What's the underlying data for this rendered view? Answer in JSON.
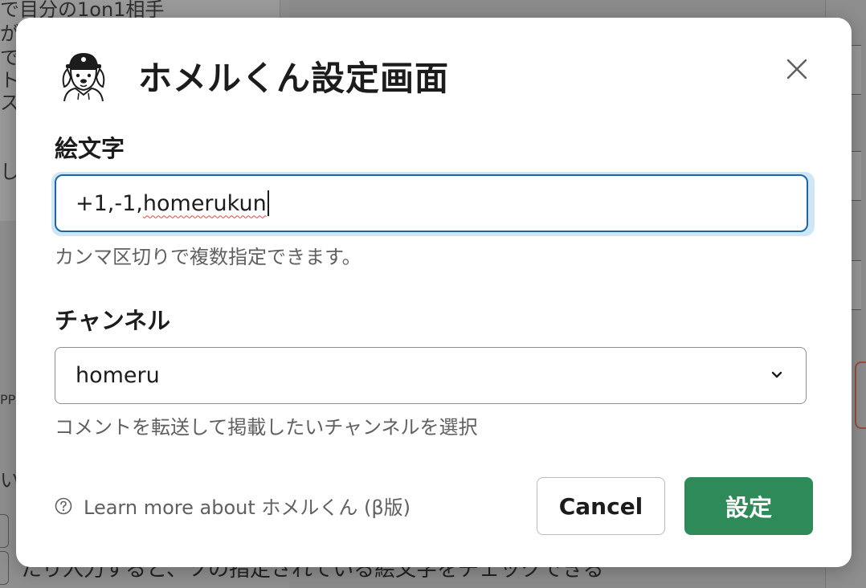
{
  "background": {
    "fragments": [
      "で目分の1on1相手",
      "が",
      "で",
      "ト",
      "ス",
      "し",
      "PP",
      "い"
    ],
    "bottom_text": "たり入力すると、ソの指定されている絵文字をチェックできる"
  },
  "modal": {
    "title": "ホメルくん設定画面",
    "app_icon": "homeru-kun-mascot-icon",
    "close_icon": "close-icon",
    "emoji_field": {
      "label": "絵文字",
      "value_prefix": "+1,-1,",
      "value_misspelled": "homerukun",
      "hint": "カンマ区切りで複数指定できます。"
    },
    "channel_field": {
      "label": "チャンネル",
      "selected": "homeru",
      "hint": "コメントを転送して掲載したいチャンネルを選択"
    },
    "footer": {
      "help_text": "Learn more about ホメルくん (β版)",
      "cancel_label": "Cancel",
      "submit_label": "設定"
    }
  },
  "colors": {
    "primary_button": "#2f8a5a",
    "focus_border": "#1d65a6",
    "focus_ring": "#cfe6f5",
    "hint_text": "#616061"
  }
}
